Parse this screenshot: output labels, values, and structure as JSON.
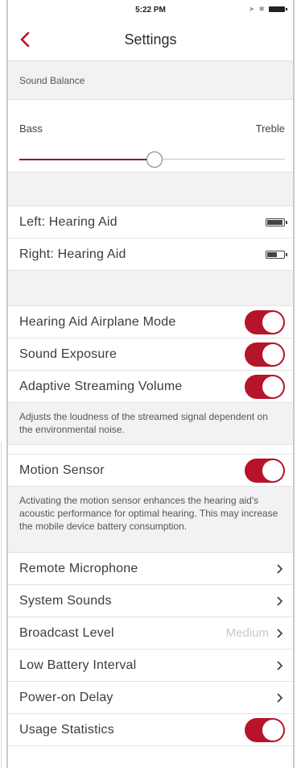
{
  "status_bar": {
    "time": "5:22 PM"
  },
  "nav": {
    "title": "Settings"
  },
  "sound_balance": {
    "header": "Sound Balance",
    "left_label": "Bass",
    "right_label": "Treble",
    "level": 0.51
  },
  "hearing_aids": [
    {
      "label": "Left: Hearing Aid",
      "battery_level": 0.95
    },
    {
      "label": "Right: Hearing Aid",
      "battery_level": 0.6
    }
  ],
  "toggles_1": [
    {
      "label": "Hearing Aid Airplane Mode",
      "on": true
    },
    {
      "label": "Sound Exposure",
      "on": true
    },
    {
      "label": "Adaptive Streaming Volume",
      "on": true
    }
  ],
  "adaptive_description": "Adjusts the loudness of the streamed signal dependent on the environmental noise.",
  "motion_sensor": {
    "label": "Motion Sensor",
    "on": true
  },
  "motion_description": "Activating the motion sensor enhances the hearing aid's acoustic performance for optimal hearing. This may increase the mobile device battery consumption.",
  "nav_rows": [
    {
      "label": "Remote Microphone",
      "value": ""
    },
    {
      "label": "System Sounds",
      "value": ""
    },
    {
      "label": "Broadcast Level",
      "value": "Medium"
    },
    {
      "label": "Low Battery Interval",
      "value": ""
    },
    {
      "label": "Power-on Delay",
      "value": ""
    }
  ],
  "usage_statistics": {
    "label": "Usage Statistics",
    "on": true
  },
  "colors": {
    "accent": "#b6142a",
    "slider_active": "#8f1a2a",
    "section_bg": "#f2f2f2"
  }
}
